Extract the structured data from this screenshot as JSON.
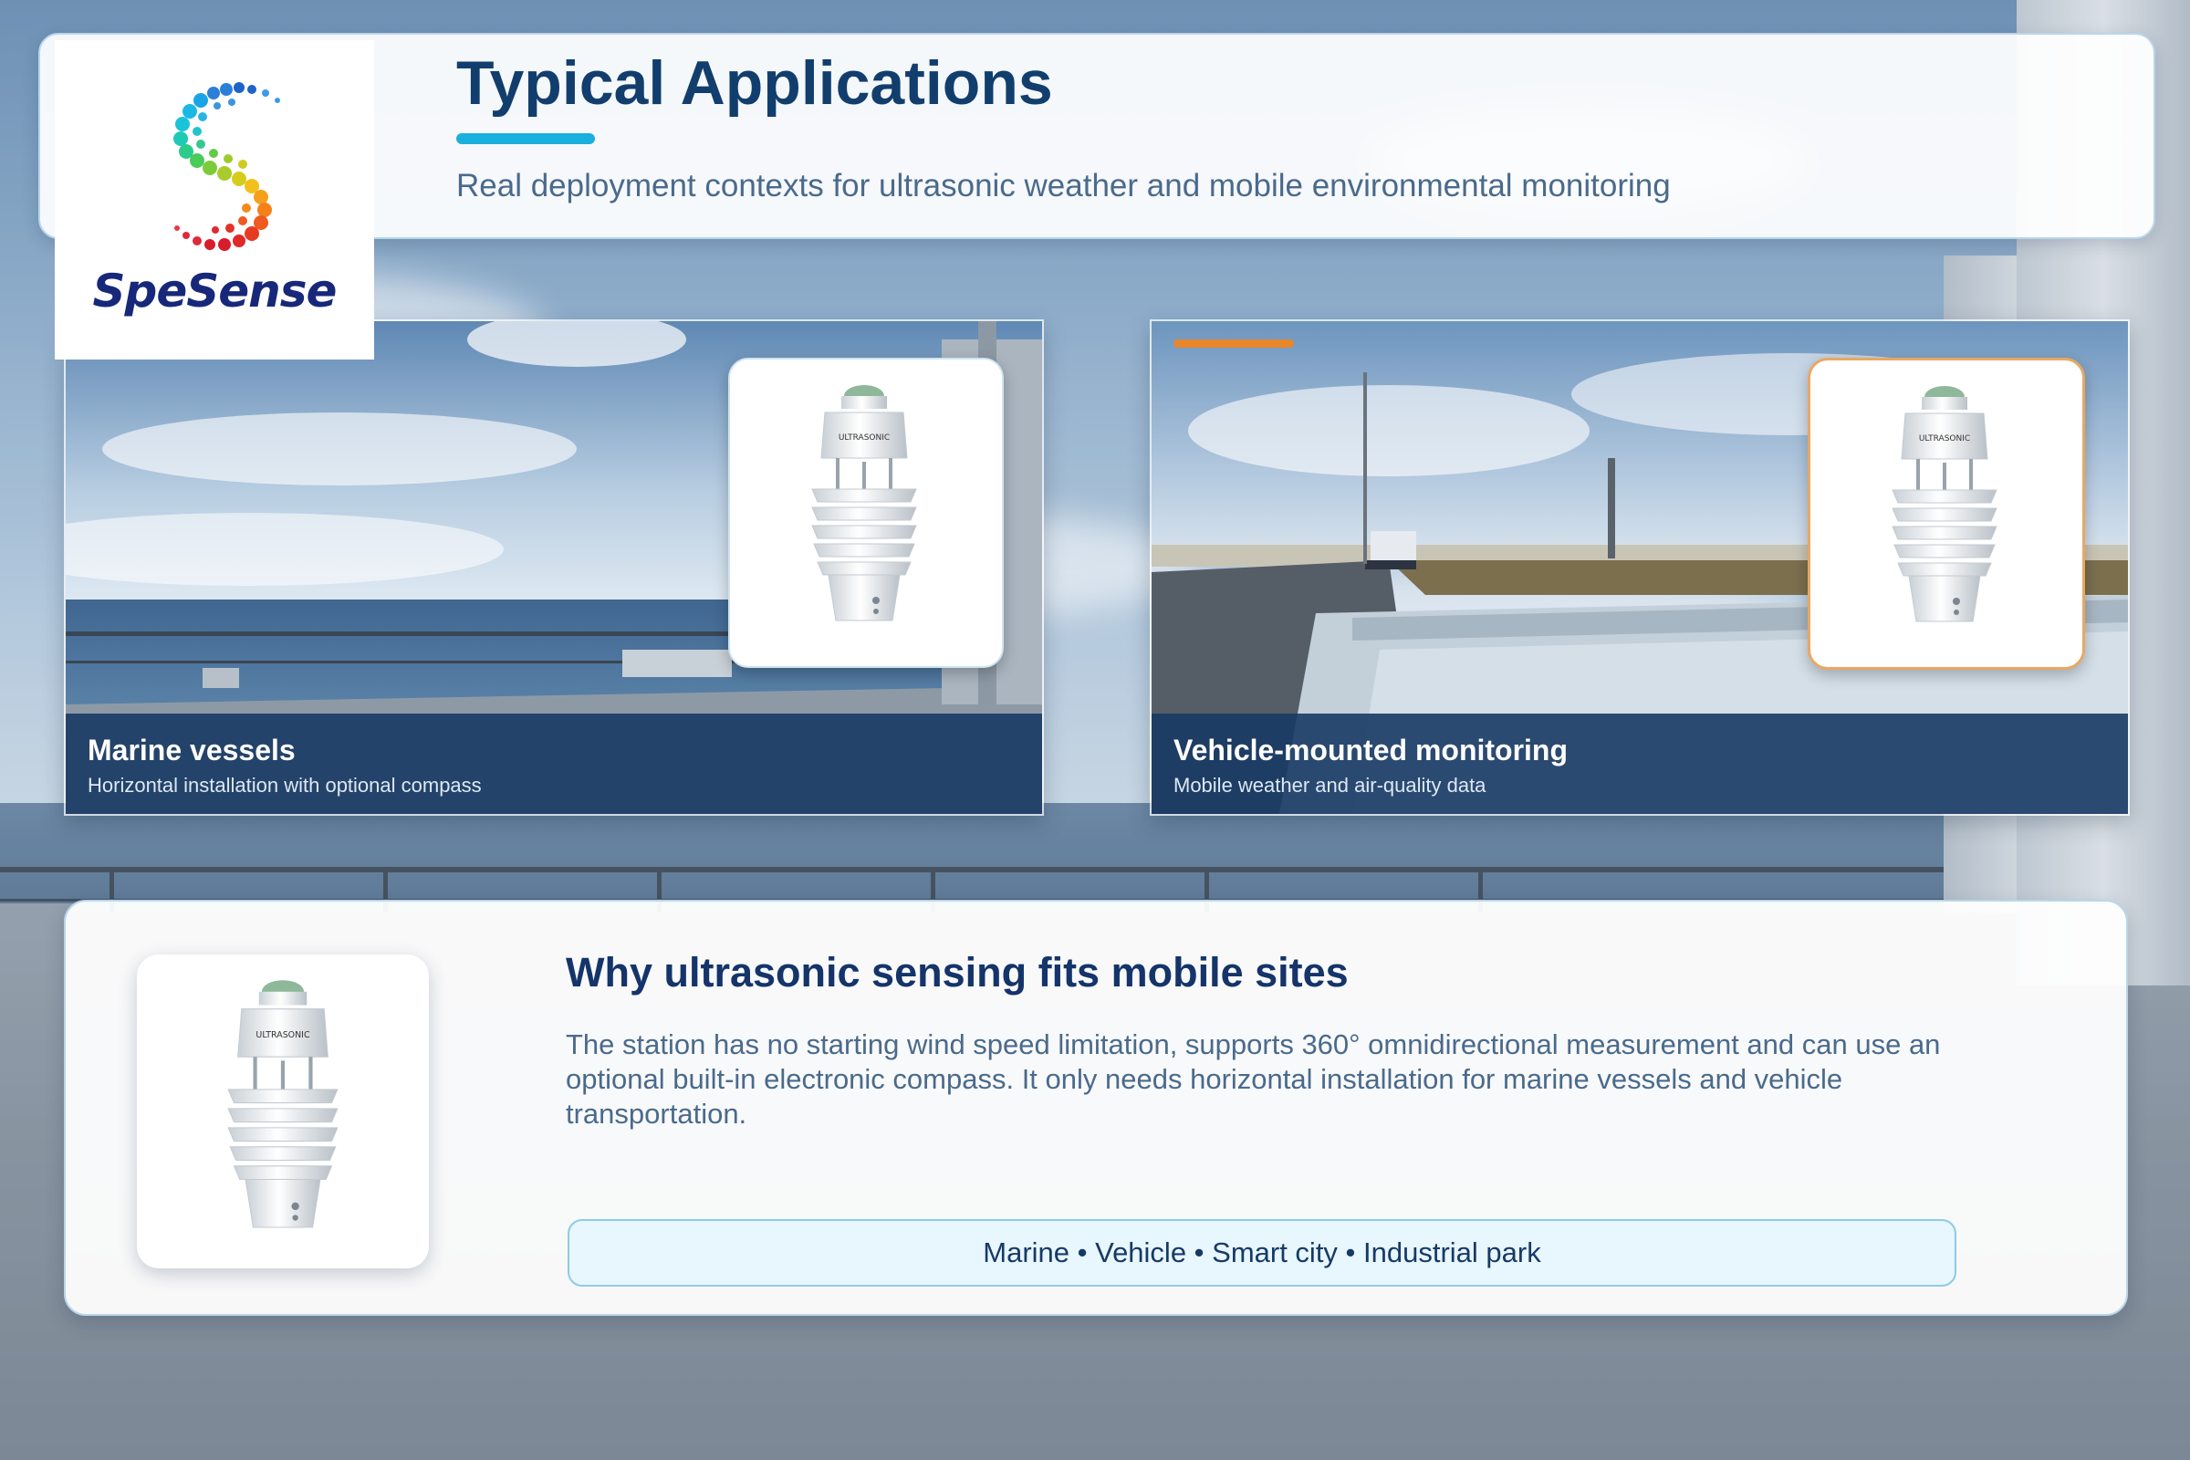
{
  "header": {
    "brand": "SpeSense",
    "title": "Typical Applications",
    "subtitle": "Real deployment contexts for ultrasonic weather and mobile environmental monitoring"
  },
  "cards": [
    {
      "title": "Marine vessels",
      "subtitle": "Horizontal installation with optional compass",
      "accent": "#1ab0dd"
    },
    {
      "title": "Vehicle-mounted monitoring",
      "subtitle": "Mobile weather and air-quality data",
      "accent": "#e8862a"
    }
  ],
  "info": {
    "title": "Why ultrasonic sensing fits mobile sites",
    "text": "The station has no starting wind speed limitation, supports 360° omnidirectional measurement and can use an optional built-in electronic compass. It only needs horizontal installation for marine vessels and vehicle transportation.",
    "tags": "Marine • Vehicle • Smart city • Industrial park"
  },
  "colors": {
    "title_navy": "#123e6e",
    "accent_cyan": "#1ab0dd",
    "accent_orange": "#e8862a",
    "caption_band": "#183a64"
  }
}
